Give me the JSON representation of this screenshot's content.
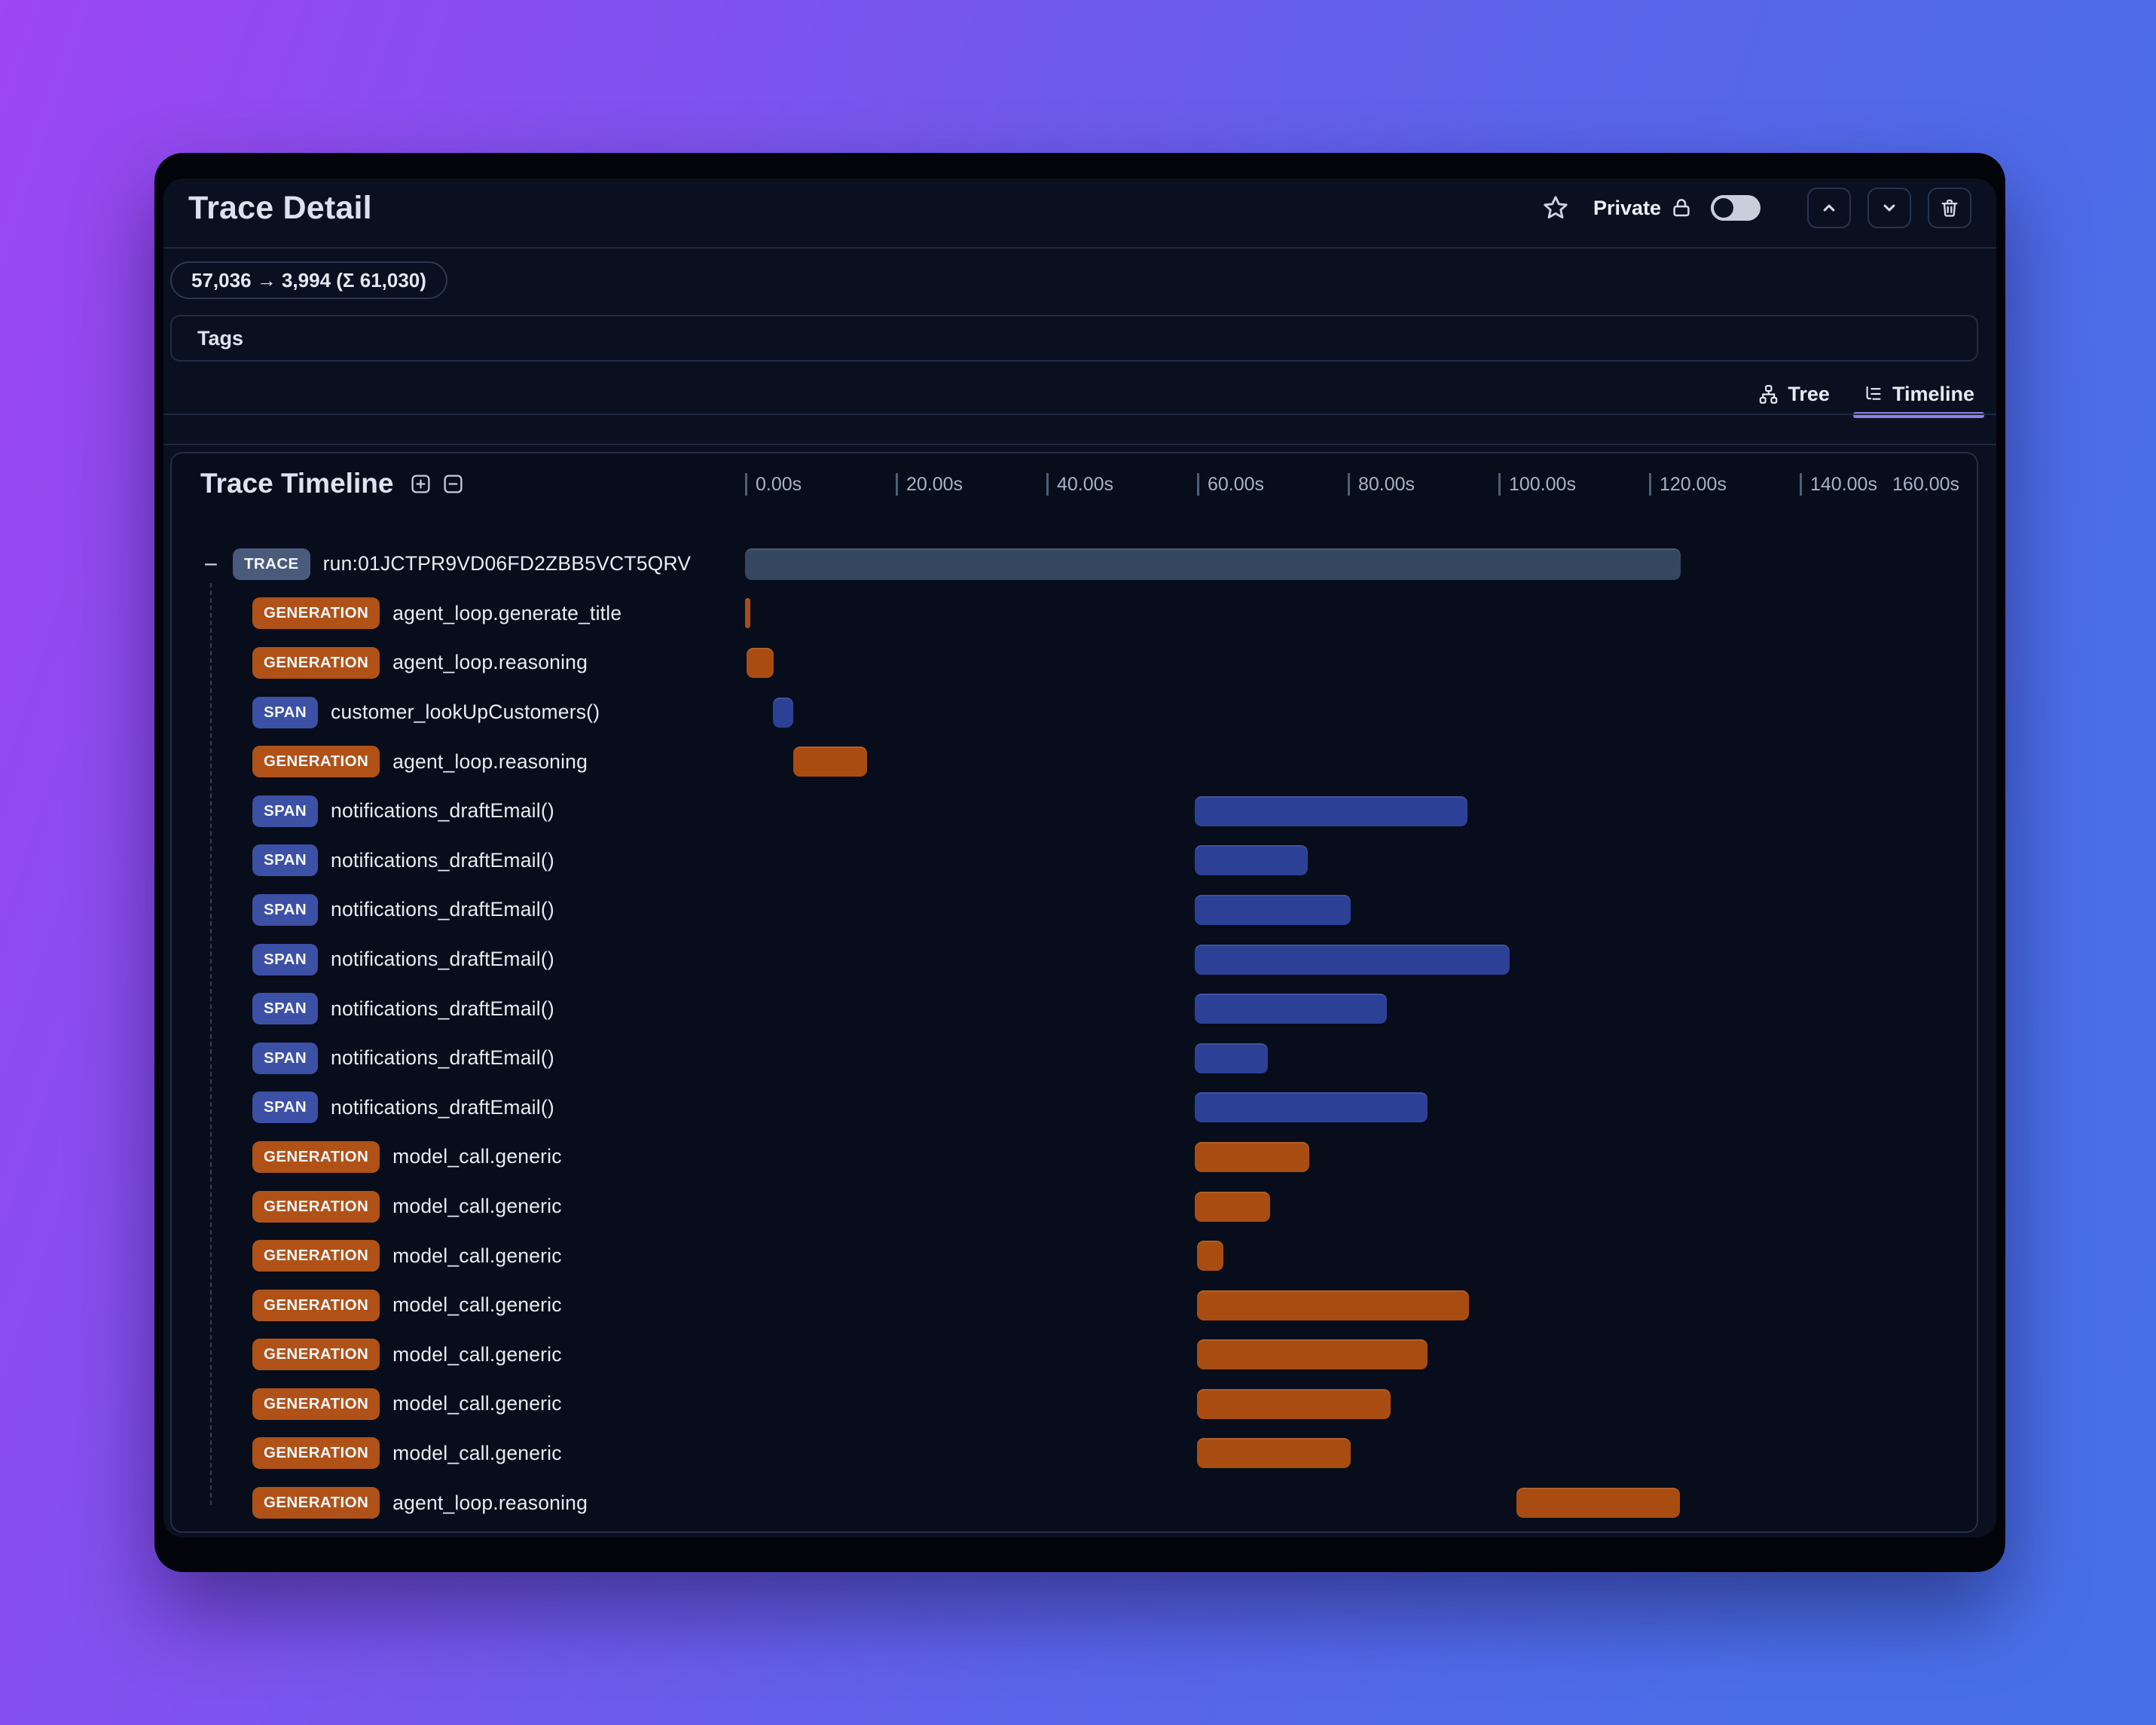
{
  "header": {
    "title": "Trace Detail",
    "favorite_icon": "star-outline",
    "privacy_label": "Private",
    "privacy_icon": "lock-outline",
    "privacy_toggle_on": false,
    "nav_buttons": [
      {
        "name": "collapse-up-button",
        "icon": "chevron-up"
      },
      {
        "name": "expand-down-button",
        "icon": "chevron-down"
      },
      {
        "name": "delete-button",
        "icon": "trash"
      }
    ]
  },
  "token_usage": {
    "text": "57,036 → 3,994 (Σ 61,030)",
    "input_tokens": "57,036",
    "output_tokens": "3,994",
    "total_tokens": "61,030"
  },
  "tags": {
    "label": "Tags"
  },
  "view_tabs": [
    {
      "label": "Tree",
      "icon": "hierarchy-icon",
      "active": false
    },
    {
      "label": "Timeline",
      "icon": "list-tree-icon",
      "active": true
    }
  ],
  "timeline": {
    "title": "Trace Timeline",
    "controls": [
      {
        "name": "expand-all-button",
        "icon": "plus-square"
      },
      {
        "name": "collapse-all-button",
        "icon": "minus-square"
      }
    ],
    "axis": {
      "max_seconds": 160,
      "tick_interval_seconds": 20,
      "ticks": [
        {
          "t": 0,
          "label": "0.00s"
        },
        {
          "t": 20,
          "label": "20.00s"
        },
        {
          "t": 40,
          "label": "40.00s"
        },
        {
          "t": 60,
          "label": "60.00s"
        },
        {
          "t": 80,
          "label": "80.00s"
        },
        {
          "t": 100,
          "label": "100.00s"
        },
        {
          "t": 120,
          "label": "120.00s"
        },
        {
          "t": 140,
          "label": "140.00s"
        }
      ],
      "end_label": {
        "t": 160,
        "label": "160.00s"
      }
    },
    "collapse_glyph": "−",
    "rows": [
      {
        "type": "TRACE",
        "name": "run:01JCTPR9VD06FD2ZBB5VCT5QRV",
        "start_s": 0,
        "end_s": 124.2,
        "level": 0
      },
      {
        "type": "GENERATION",
        "name": "agent_loop.generate_title",
        "start_s": 0,
        "end_s": 0.65,
        "level": 1
      },
      {
        "type": "GENERATION",
        "name": "agent_loop.reasoning",
        "start_s": 0.2,
        "end_s": 3.8,
        "level": 1
      },
      {
        "type": "SPAN",
        "name": "customer_lookUpCustomers()",
        "start_s": 3.7,
        "end_s": 6.4,
        "level": 1
      },
      {
        "type": "GENERATION",
        "name": "agent_loop.reasoning",
        "start_s": 6.4,
        "end_s": 16.2,
        "level": 1
      },
      {
        "type": "SPAN",
        "name": "notifications_draftEmail()",
        "start_s": 59.7,
        "end_s": 95.9,
        "level": 1
      },
      {
        "type": "SPAN",
        "name": "notifications_draftEmail()",
        "start_s": 59.7,
        "end_s": 74.7,
        "level": 1
      },
      {
        "type": "SPAN",
        "name": "notifications_draftEmail()",
        "start_s": 59.7,
        "end_s": 80.4,
        "level": 1
      },
      {
        "type": "SPAN",
        "name": "notifications_draftEmail()",
        "start_s": 59.7,
        "end_s": 101.5,
        "level": 1
      },
      {
        "type": "SPAN",
        "name": "notifications_draftEmail()",
        "start_s": 59.7,
        "end_s": 85.2,
        "level": 1
      },
      {
        "type": "SPAN",
        "name": "notifications_draftEmail()",
        "start_s": 59.7,
        "end_s": 69.4,
        "level": 1
      },
      {
        "type": "SPAN",
        "name": "notifications_draftEmail()",
        "start_s": 59.7,
        "end_s": 90.6,
        "level": 1
      },
      {
        "type": "GENERATION",
        "name": "model_call.generic",
        "start_s": 59.7,
        "end_s": 74.9,
        "level": 1
      },
      {
        "type": "GENERATION",
        "name": "model_call.generic",
        "start_s": 59.7,
        "end_s": 69.7,
        "level": 1
      },
      {
        "type": "GENERATION",
        "name": "model_call.generic",
        "start_s": 60.0,
        "end_s": 63.5,
        "level": 1
      },
      {
        "type": "GENERATION",
        "name": "model_call.generic",
        "start_s": 60.0,
        "end_s": 96.1,
        "level": 1
      },
      {
        "type": "GENERATION",
        "name": "model_call.generic",
        "start_s": 60.0,
        "end_s": 90.6,
        "level": 1
      },
      {
        "type": "GENERATION",
        "name": "model_call.generic",
        "start_s": 60.0,
        "end_s": 85.7,
        "level": 1
      },
      {
        "type": "GENERATION",
        "name": "model_call.generic",
        "start_s": 60.0,
        "end_s": 80.4,
        "level": 1
      },
      {
        "type": "GENERATION",
        "name": "agent_loop.reasoning",
        "start_s": 102.4,
        "end_s": 124.1,
        "level": 1
      }
    ]
  },
  "colors": {
    "background_gradient_start": "#9d46f1",
    "background_gradient_end": "#486fe8",
    "window_frame": "#020409",
    "panel_bg": "#0a101f",
    "card_bg": "#070d1a",
    "trace_badge": "#4a5a7b",
    "generation_badge": "#b05217",
    "span_badge": "#3c50a5",
    "trace_bar": "#35465f",
    "generation_bar": "#a84c12",
    "span_bar": "#2c4095",
    "active_tab_indicator": "#8d80e3"
  }
}
